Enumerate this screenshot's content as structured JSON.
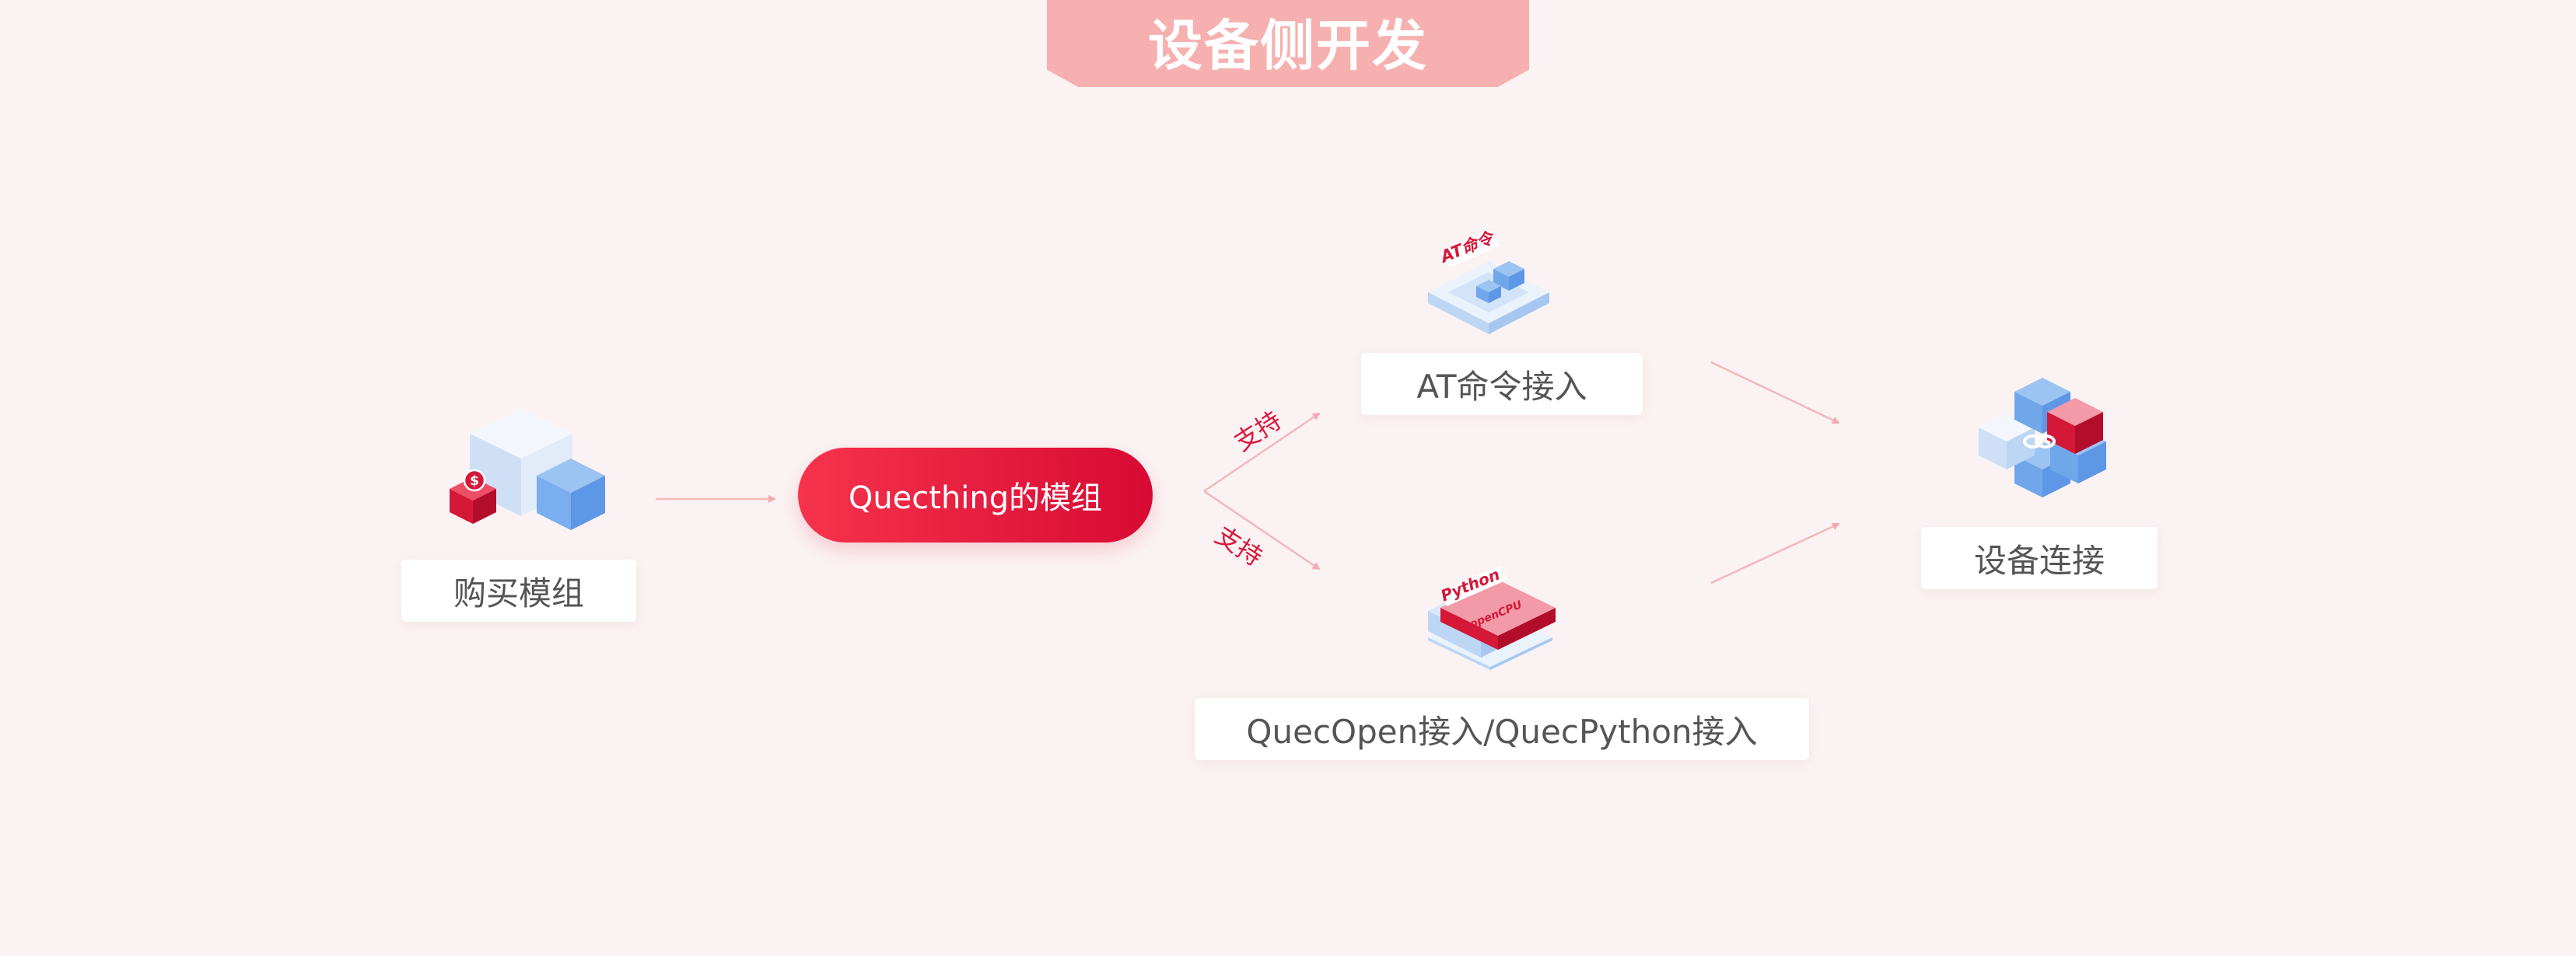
{
  "title": "设备侧开发",
  "nodes": {
    "buy_module": "购买模组",
    "quecthing_module": "Quecthing的模组",
    "at_access": "AT命令接入",
    "quecopen_access": "QuecOpen接入/QuecPython接入",
    "device_connect": "设备连接"
  },
  "edge_labels": {
    "upper": "支持",
    "lower": "支持"
  },
  "icon_texts": {
    "at_icon": "AT命令",
    "python_icon_top": "Python",
    "python_icon_bottom": "openCPU",
    "coin_symbol": "$"
  },
  "colors": {
    "background": "#fbf3f3",
    "banner": "#f6b0b0",
    "accent_red": "#d80a33",
    "connector": "#f4b6bd",
    "light_blue": "#bcd6f4",
    "mid_blue": "#6fa7ea"
  },
  "icons": [
    "cubes-purchase-icon",
    "at-command-icon",
    "python-opencpu-icon",
    "linked-cubes-icon"
  ]
}
